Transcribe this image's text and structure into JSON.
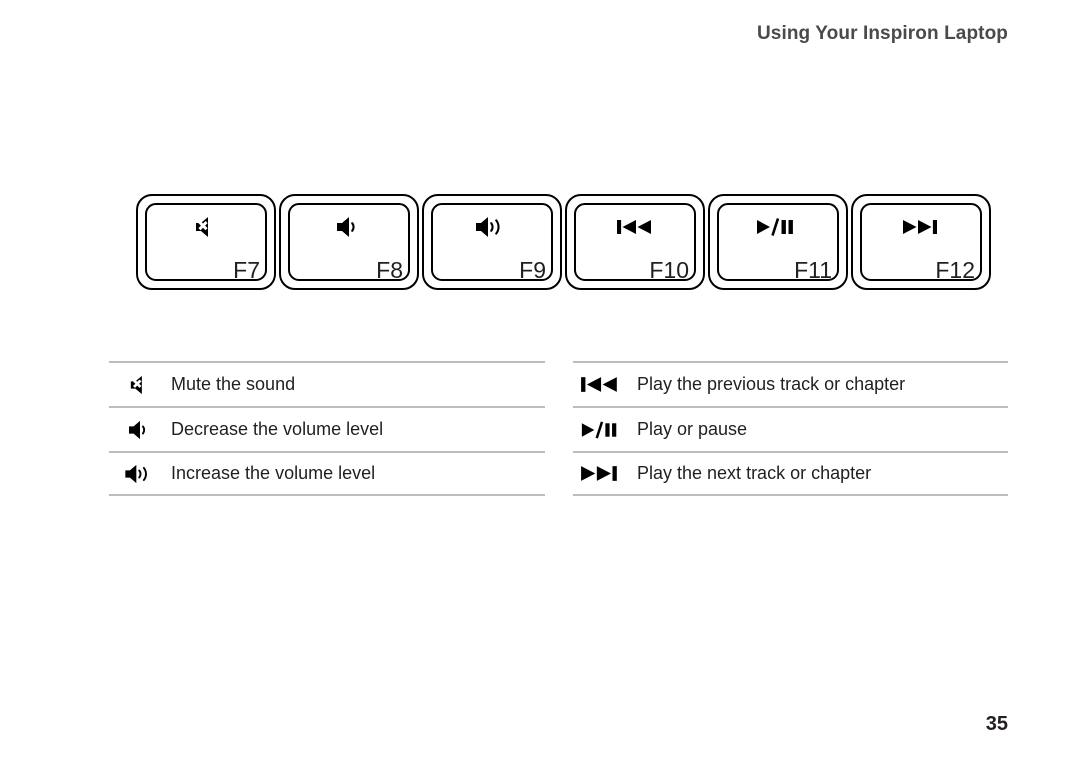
{
  "header": {
    "title": "Using Your Inspiron Laptop"
  },
  "keys": [
    {
      "label": "F7",
      "icon": "speaker-mute-icon"
    },
    {
      "label": "F8",
      "icon": "volume-down-icon"
    },
    {
      "label": "F9",
      "icon": "volume-up-icon"
    },
    {
      "label": "F10",
      "icon": "previous-track-icon"
    },
    {
      "label": "F11",
      "icon": "play-pause-icon"
    },
    {
      "label": "F12",
      "icon": "next-track-icon"
    }
  ],
  "legend_left": {
    "rows": [
      {
        "icon": "speaker-mute-icon",
        "text": "Mute the sound"
      },
      {
        "icon": "volume-down-icon",
        "text": "Decrease the volume level"
      },
      {
        "icon": "volume-up-icon",
        "text": "Increase the volume level"
      }
    ]
  },
  "legend_right": {
    "rows": [
      {
        "icon": "previous-track-icon",
        "text": "Play the previous track or chapter"
      },
      {
        "icon": "play-pause-icon",
        "text": "Play or pause"
      },
      {
        "icon": "next-track-icon",
        "text": "Play the next track or chapter"
      }
    ]
  },
  "footer": {
    "page_number": "35"
  },
  "colors": {
    "text": "#231f20",
    "header_text": "#4a4a4a",
    "rule": "#bdbdbd",
    "key_border": "#000000",
    "background": "#ffffff"
  }
}
